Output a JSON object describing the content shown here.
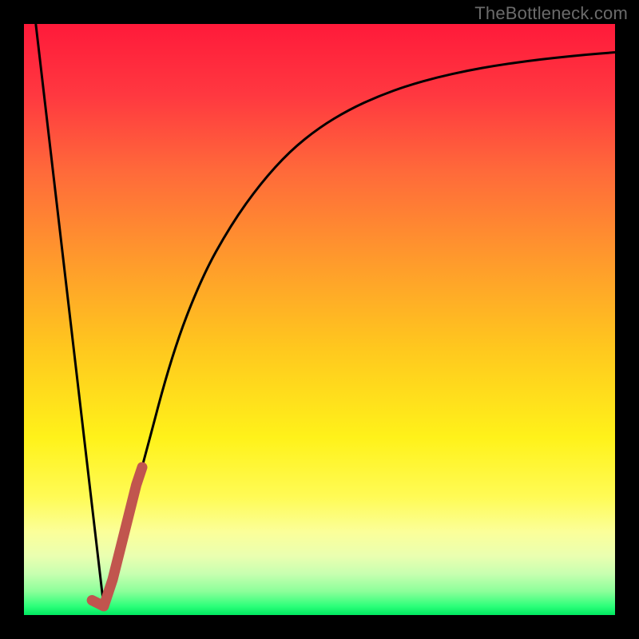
{
  "watermark": "TheBottleneck.com",
  "chart_data": {
    "type": "line",
    "title": "",
    "xlabel": "",
    "ylabel": "",
    "xlim": [
      0,
      100
    ],
    "ylim": [
      0,
      100
    ],
    "grid": false,
    "legend": false,
    "series": [
      {
        "name": "bottleneck-curve",
        "type": "line",
        "color": "#000000",
        "x": [
          2,
          13.5,
          20,
          25,
          30,
          35,
          40,
          45,
          50,
          55,
          60,
          65,
          70,
          75,
          80,
          85,
          90,
          95,
          100
        ],
        "y": [
          100,
          1.5,
          25,
          44,
          57,
          66,
          73,
          78.5,
          82.5,
          85.5,
          87.8,
          89.6,
          91,
          92.1,
          93,
          93.7,
          94.3,
          94.8,
          95.2
        ]
      },
      {
        "name": "optimal-segment",
        "type": "line",
        "color": "#c1554e",
        "thick": true,
        "x": [
          11.5,
          13.5,
          15,
          17,
          19,
          20
        ],
        "y": [
          2.5,
          1.5,
          6,
          14,
          22,
          25
        ]
      }
    ],
    "background_gradient": {
      "stops": [
        {
          "offset": 0.0,
          "color": "#ff1a3a"
        },
        {
          "offset": 0.12,
          "color": "#ff3840"
        },
        {
          "offset": 0.25,
          "color": "#ff6a3a"
        },
        {
          "offset": 0.4,
          "color": "#ff9a2c"
        },
        {
          "offset": 0.55,
          "color": "#ffc81e"
        },
        {
          "offset": 0.7,
          "color": "#fff21a"
        },
        {
          "offset": 0.8,
          "color": "#fffb55"
        },
        {
          "offset": 0.86,
          "color": "#fbff9a"
        },
        {
          "offset": 0.9,
          "color": "#eaffb0"
        },
        {
          "offset": 0.93,
          "color": "#c8ffb0"
        },
        {
          "offset": 0.96,
          "color": "#8cff9a"
        },
        {
          "offset": 0.985,
          "color": "#2dff7a"
        },
        {
          "offset": 1.0,
          "color": "#00e860"
        }
      ]
    }
  }
}
